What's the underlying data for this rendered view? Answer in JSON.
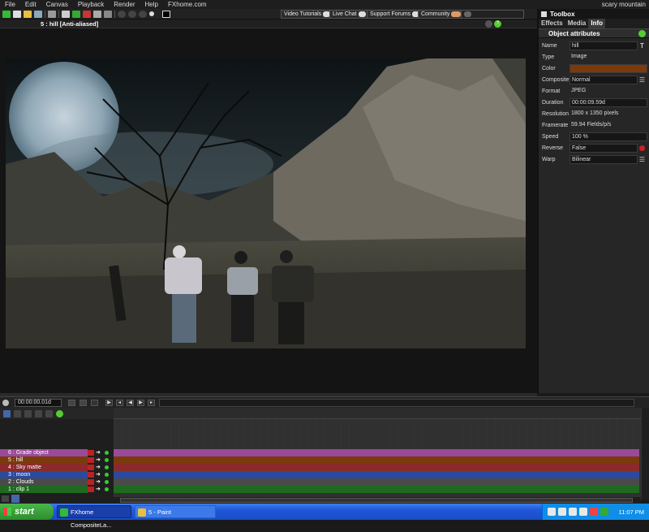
{
  "menu": [
    "File",
    "Edit",
    "Canvas",
    "Playback",
    "Render",
    "Help",
    "FXhome.com"
  ],
  "project_name": "scary mountain",
  "web_buttons": {
    "tutorials": "Video Tutorials",
    "chat": "Live Chat",
    "forums": "Support Forums",
    "community": "Community"
  },
  "viewer": {
    "title": "5 : hill [Anti-aliased]"
  },
  "toolbox": {
    "title": "Toolbox",
    "tabs": [
      "Effects",
      "Media",
      "Info"
    ],
    "active_tab": "Info",
    "section": "Object attributes",
    "attributes": [
      {
        "key": "Name",
        "value": "hill"
      },
      {
        "key": "Type",
        "value": "Image"
      },
      {
        "key": "Color",
        "value": ""
      },
      {
        "key": "Composite",
        "value": "Normal"
      },
      {
        "key": "Format",
        "value": "JPEG"
      },
      {
        "key": "Duration",
        "value": "00:00:09.59d"
      },
      {
        "key": "Resolution",
        "value": "1800 x 1350 pixels"
      },
      {
        "key": "Framerate",
        "value": "59.94 Fields/p/s"
      },
      {
        "key": "Speed",
        "value": "100 %"
      },
      {
        "key": "Reverse",
        "value": "False"
      },
      {
        "key": "Warp",
        "value": "Bilinear"
      }
    ],
    "color_swatch": "#7a3a0c"
  },
  "timeline": {
    "time": "00:00:00.01d",
    "layers": [
      {
        "label": "6 : Grade object",
        "color": "#9a4a9a"
      },
      {
        "label": "5 : hill",
        "color": "#7a3a0c"
      },
      {
        "label": "4 : Sky matte",
        "color": "#8a2a2a"
      },
      {
        "label": "3 : moon",
        "color": "#2a4aa0"
      },
      {
        "label": "2 : Clouds",
        "color": "#4a4a4a"
      },
      {
        "label": "1 : clip 1",
        "color": "#1f6a1f"
      }
    ]
  },
  "taskbar": {
    "start": "start",
    "tasks": [
      "FXhome CompositeLa...",
      "5 - Paint"
    ],
    "clock": "11:07 PM"
  }
}
